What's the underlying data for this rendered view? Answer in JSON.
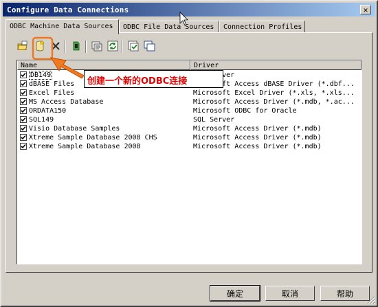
{
  "window": {
    "title": "Configure Data Connections",
    "close_glyph": "✕"
  },
  "tabs": [
    {
      "label": "ODBC Machine Data Sources",
      "active": true
    },
    {
      "label": "ODBC File Data Sources",
      "active": false
    },
    {
      "label": "Connection Profiles",
      "active": false
    }
  ],
  "toolbar": {
    "buttons": [
      {
        "name": "open-folder-icon"
      },
      {
        "name": "new-database-icon",
        "highlighted": true
      },
      {
        "name": "delete-x-icon"
      },
      {
        "name": "test-connection-icon"
      },
      {
        "name": "properties-icon"
      },
      {
        "name": "refresh-icon"
      },
      {
        "name": "select-all-icon"
      },
      {
        "name": "copy-icon"
      }
    ],
    "highlight_color": "#f07820"
  },
  "list": {
    "columns": [
      "Name",
      "Driver"
    ],
    "rows": [
      {
        "name": "DB149",
        "driver": "SQL Server",
        "checked": true,
        "selected": true
      },
      {
        "name": "dBASE Files",
        "driver": "Microsoft Access dBASE Driver (*.dbf...",
        "checked": true
      },
      {
        "name": "Excel Files",
        "driver": "Microsoft Excel Driver (*.xls, *.xls...",
        "checked": true
      },
      {
        "name": "MS Access Database",
        "driver": "Microsoft Access Driver (*.mdb, *.ac...",
        "checked": true
      },
      {
        "name": "ORDATA150",
        "driver": "Microsoft ODBC for Oracle",
        "checked": true
      },
      {
        "name": "SQL149",
        "driver": "SQL Server",
        "checked": true
      },
      {
        "name": "Visio Database Samples",
        "driver": "Microsoft Access Driver (*.mdb)",
        "checked": true
      },
      {
        "name": "Xtreme Sample Database 2008 CHS",
        "driver": "Microsoft Access Driver (*.mdb)",
        "checked": true
      },
      {
        "name": "Xtreme Sample Database 2008",
        "driver": "Microsoft Access Driver (*.mdb)",
        "checked": true
      }
    ]
  },
  "callout": {
    "text": "创建一个新的ODBC连接",
    "text_color": "#e00000"
  },
  "buttons": {
    "ok": "确定",
    "cancel": "取消",
    "help": "帮助"
  }
}
